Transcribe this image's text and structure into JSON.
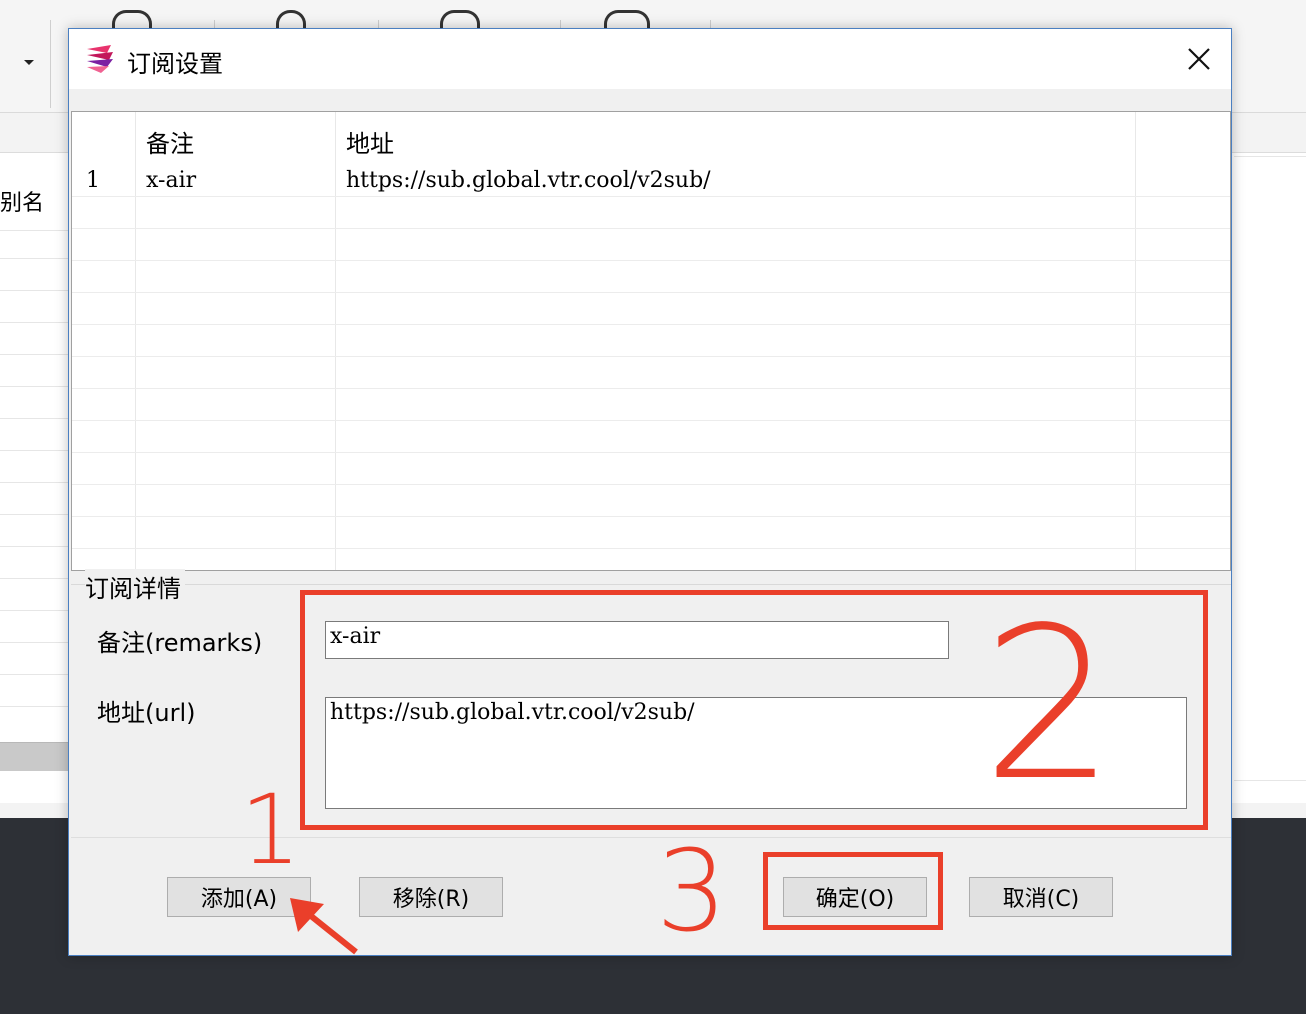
{
  "background": {
    "column_header_partial": "别名"
  },
  "dialog": {
    "title": "订阅设置",
    "close_glyph": "✕",
    "grid": {
      "columns": [
        "",
        "备注",
        "地址"
      ],
      "rows": [
        {
          "index": "1",
          "remarks": "x-air",
          "url": "https://sub.global.vtr.cool/v2sub/"
        }
      ]
    },
    "details": {
      "group_title": "订阅详情",
      "remarks_label": "备注(remarks)",
      "remarks_value": "x-air",
      "url_label": "地址(url)",
      "url_value": "https://sub.global.vtr.cool/v2sub/"
    },
    "buttons": {
      "add": "添加(A)",
      "remove": "移除(R)",
      "ok": "确定(O)",
      "cancel": "取消(C)"
    }
  },
  "annotations": {
    "color": "#ea3f2a",
    "step1": "1",
    "step2": "2",
    "step3": "3"
  }
}
